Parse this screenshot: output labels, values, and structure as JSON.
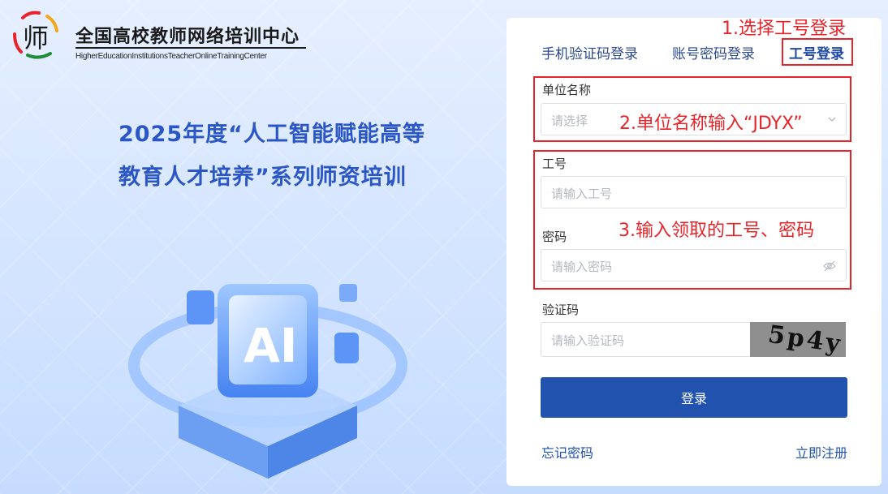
{
  "brand": {
    "title": "全国高校教师网络培训中心",
    "subtitle": "HigherEducationInstitutionsTeacherOnlineTrainingCenter",
    "logo_glyph": "师"
  },
  "headline": {
    "line1": "2025年度“人工智能赋能高等",
    "line2": "教育人才培养”系列师资培训"
  },
  "hero": {
    "badge_text": "AI"
  },
  "tabs": [
    {
      "label": "手机验证码登录"
    },
    {
      "label": "账号密码登录"
    },
    {
      "label": "工号登录",
      "active": true
    }
  ],
  "annotations": {
    "step1": "1.选择工号登录",
    "step2": "2.单位名称输入“JDYX”",
    "step3": "3.输入领取的工号、密码"
  },
  "form": {
    "unit": {
      "label": "单位名称",
      "placeholder": "请选择"
    },
    "employee_id": {
      "label": "工号",
      "placeholder": "请输入工号"
    },
    "password": {
      "label": "密码",
      "placeholder": "请输入密码"
    },
    "captcha": {
      "label": "验证码",
      "placeholder": "请输入验证码",
      "image_text": "5p4y"
    },
    "submit_label": "登录"
  },
  "links": {
    "forgot_password": "忘记密码",
    "register": "立即注册"
  },
  "colors": {
    "primary": "#2152ae",
    "annotation_red": "#e8242a",
    "headline_blue": "#2b56c6"
  }
}
